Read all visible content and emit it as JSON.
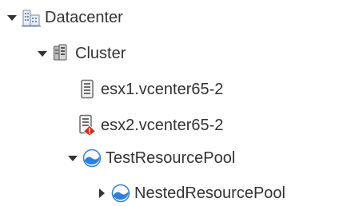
{
  "tree": {
    "nodes": [
      {
        "label": "Datacenter",
        "type": "datacenter",
        "expanded": true,
        "icon": "datacenter-icon"
      },
      {
        "label": "Cluster",
        "type": "cluster",
        "expanded": true,
        "icon": "cluster-icon"
      },
      {
        "label": "esx1.vcenter65-2",
        "type": "host",
        "status": "normal",
        "icon": "host-icon"
      },
      {
        "label": "esx2.vcenter65-2",
        "type": "host",
        "status": "error",
        "icon": "host-error-icon"
      },
      {
        "label": "TestResourcePool",
        "type": "resource-pool",
        "expanded": true,
        "icon": "resource-pool-icon"
      },
      {
        "label": "NestedResourcePool",
        "type": "resource-pool",
        "expanded": false,
        "icon": "resource-pool-icon"
      }
    ]
  },
  "colors": {
    "text": "#333333",
    "toggle": "#333333",
    "error_badge": "#d9271a",
    "pool_blue": "#2f7fd8",
    "server_gray": "#6e6e6e"
  }
}
